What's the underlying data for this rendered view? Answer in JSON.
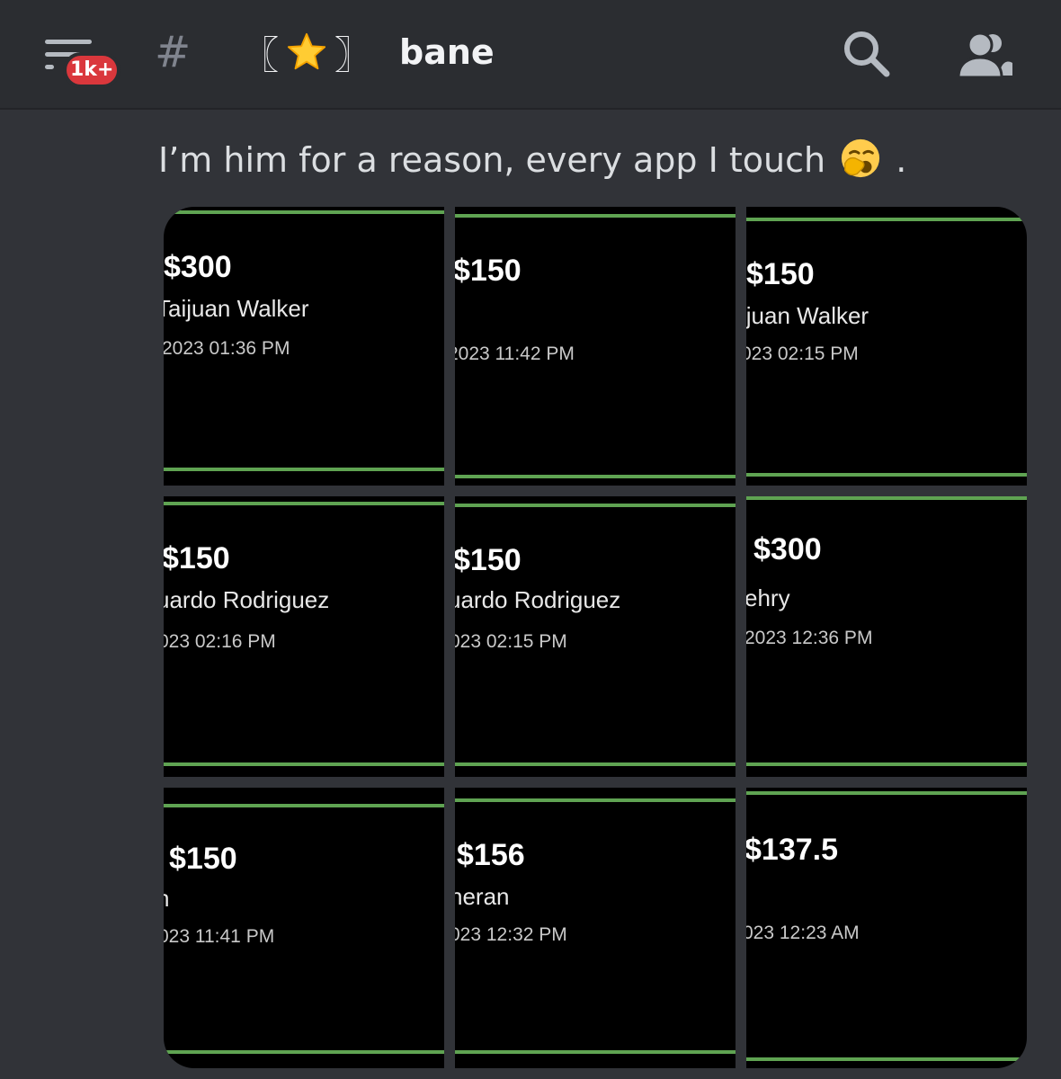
{
  "header": {
    "badge": "1k+",
    "hash": "#",
    "channel_prefix_left": "〖",
    "channel_prefix_right": "〗",
    "channel_name": "bane",
    "icons": [
      "menu-icon",
      "hashtag-icon",
      "star-icon",
      "search-icon",
      "members-icon"
    ]
  },
  "message": {
    "text_before_emoji": "I’m him for a reason, every app I touch",
    "text_after_emoji": ".",
    "emoji": "yawning-face-icon"
  },
  "tiles": [
    {
      "amount": "$300",
      "name": "Taijuan Walker",
      "time": "2023 01:36 PM"
    },
    {
      "amount": "$150",
      "name": "",
      "time": "2023 11:42 PM"
    },
    {
      "amount": "$150",
      "name": "ijuan Walker",
      "time": "023 02:15 PM"
    },
    {
      "amount": "$150",
      "name": "uardo Rodriguez",
      "time": "023 02:16 PM"
    },
    {
      "amount": "$150",
      "name": "uardo Rodriguez",
      "time": "023 02:15 PM"
    },
    {
      "amount": "$300",
      "name": "ehry",
      "time": "2023 12:36 PM"
    },
    {
      "amount": "$150",
      "name": "n",
      "time": "023 11:41 PM"
    },
    {
      "amount": "$156",
      "name": "neran",
      "time": "023 12:32 PM"
    },
    {
      "amount": "$137.5",
      "name": "",
      "time": "023 12:23 AM"
    }
  ],
  "colors": {
    "background": "#313338",
    "header": "#2b2d31",
    "badge": "#da373c",
    "tile_background": "#000000",
    "tile_accent": "#5fa352"
  }
}
